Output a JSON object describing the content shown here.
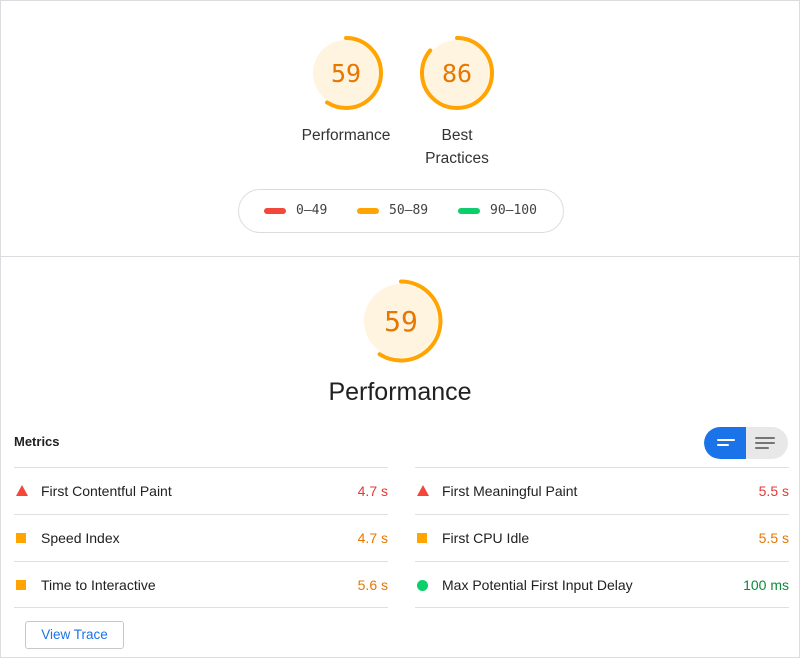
{
  "colors": {
    "fail": "#f4473b",
    "average": "#ffa400",
    "pass": "#0cce6b",
    "gauge_bg": "#fff4e0",
    "gauge_text": "#e67700",
    "accent": "#1a73e8"
  },
  "summary": {
    "gauges": [
      {
        "score": 59,
        "score_text": "59",
        "label": "Performance"
      },
      {
        "score": 86,
        "score_text": "86",
        "label_line1": "Best",
        "label_line2": "Practices"
      }
    ],
    "legend": [
      {
        "range": "0–49",
        "color": "#f4473b"
      },
      {
        "range": "50–89",
        "color": "#ffa400"
      },
      {
        "range": "90–100",
        "color": "#0cce6b"
      }
    ]
  },
  "performance": {
    "score": 59,
    "score_text": "59",
    "title": "Performance",
    "metrics_title": "Metrics",
    "toggle_icons": [
      "expanded-view-icon",
      "list-view-icon"
    ],
    "metrics_left": [
      {
        "name": "First Contentful Paint",
        "value": "4.7 s",
        "rating": "fail"
      },
      {
        "name": "Speed Index",
        "value": "4.7 s",
        "rating": "average"
      },
      {
        "name": "Time to Interactive",
        "value": "5.6 s",
        "rating": "average"
      }
    ],
    "metrics_right": [
      {
        "name": "First Meaningful Paint",
        "value": "5.5 s",
        "rating": "fail"
      },
      {
        "name": "First CPU Idle",
        "value": "5.5 s",
        "rating": "average"
      },
      {
        "name": "Max Potential First Input Delay",
        "value": "100 ms",
        "rating": "pass"
      }
    ],
    "view_trace_label": "View Trace"
  }
}
